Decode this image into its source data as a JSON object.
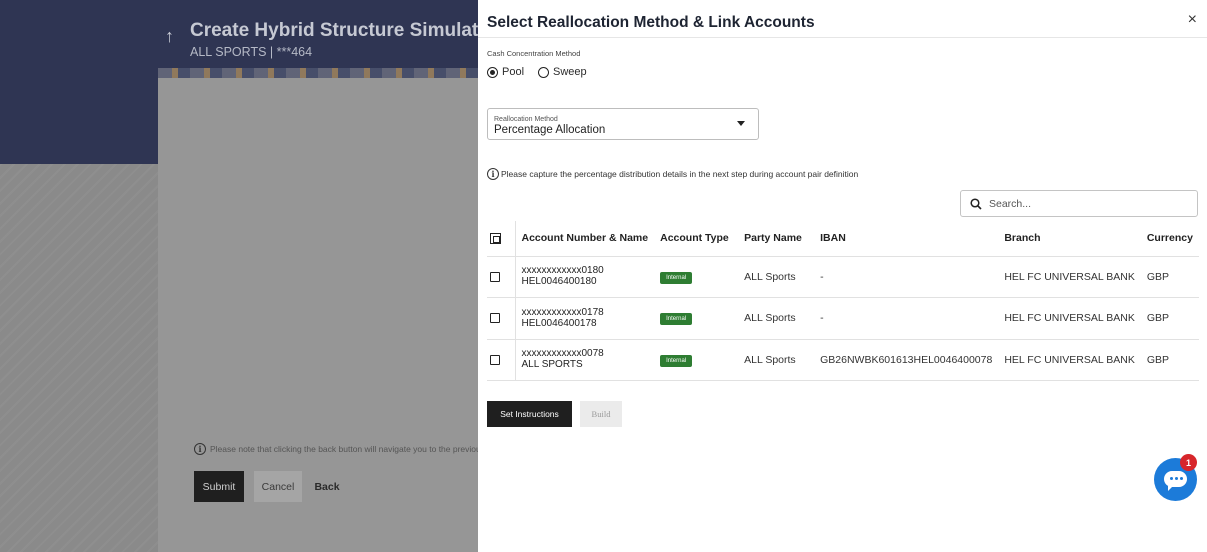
{
  "background": {
    "title": "Create Hybrid Structure Simulation",
    "subtitle": "ALL SPORTS | ***464",
    "note": "Please note that clicking the back button will navigate you to the previous page.",
    "buttons": {
      "submit": "Submit",
      "cancel": "Cancel",
      "back": "Back"
    }
  },
  "modal": {
    "title": "Select Reallocation Method & Link Accounts",
    "close_symbol": "×",
    "cash_concentration": {
      "label": "Cash Concentration Method",
      "options": [
        {
          "label": "Pool",
          "selected": true
        },
        {
          "label": "Sweep",
          "selected": false
        }
      ]
    },
    "reallocation": {
      "label": "Reallocation Method",
      "value": "Percentage Allocation"
    },
    "info": "Please capture the percentage distribution details in the next step during account pair definition",
    "search": {
      "placeholder": "Search..."
    },
    "table": {
      "headers": [
        "Account Number & Name",
        "Account Type",
        "Party Name",
        "IBAN",
        "Branch",
        "Currency"
      ],
      "rows": [
        {
          "account_number": "xxxxxxxxxxxx0180",
          "account_name": "HEL0046400180",
          "type": "Internal",
          "party": "ALL Sports",
          "iban": "-",
          "branch": "HEL FC UNIVERSAL BANK",
          "currency": "GBP"
        },
        {
          "account_number": "xxxxxxxxxxxx0178",
          "account_name": "HEL0046400178",
          "type": "Internal",
          "party": "ALL Sports",
          "iban": "-",
          "branch": "HEL FC UNIVERSAL BANK",
          "currency": "GBP"
        },
        {
          "account_number": "xxxxxxxxxxxx0078",
          "account_name": "ALL SPORTS",
          "type": "Internal",
          "party": "ALL Sports",
          "iban": "GB26NWBK601613HEL0046400078",
          "branch": "HEL FC UNIVERSAL BANK",
          "currency": "GBP"
        }
      ]
    },
    "buttons": {
      "set_instructions": "Set Instructions",
      "build": "Build"
    },
    "chat_badge": "1"
  },
  "colors": {
    "accent_blue": "#1c7bd9",
    "badge_green": "#2e7d32",
    "header_navy": "#2f3553"
  }
}
